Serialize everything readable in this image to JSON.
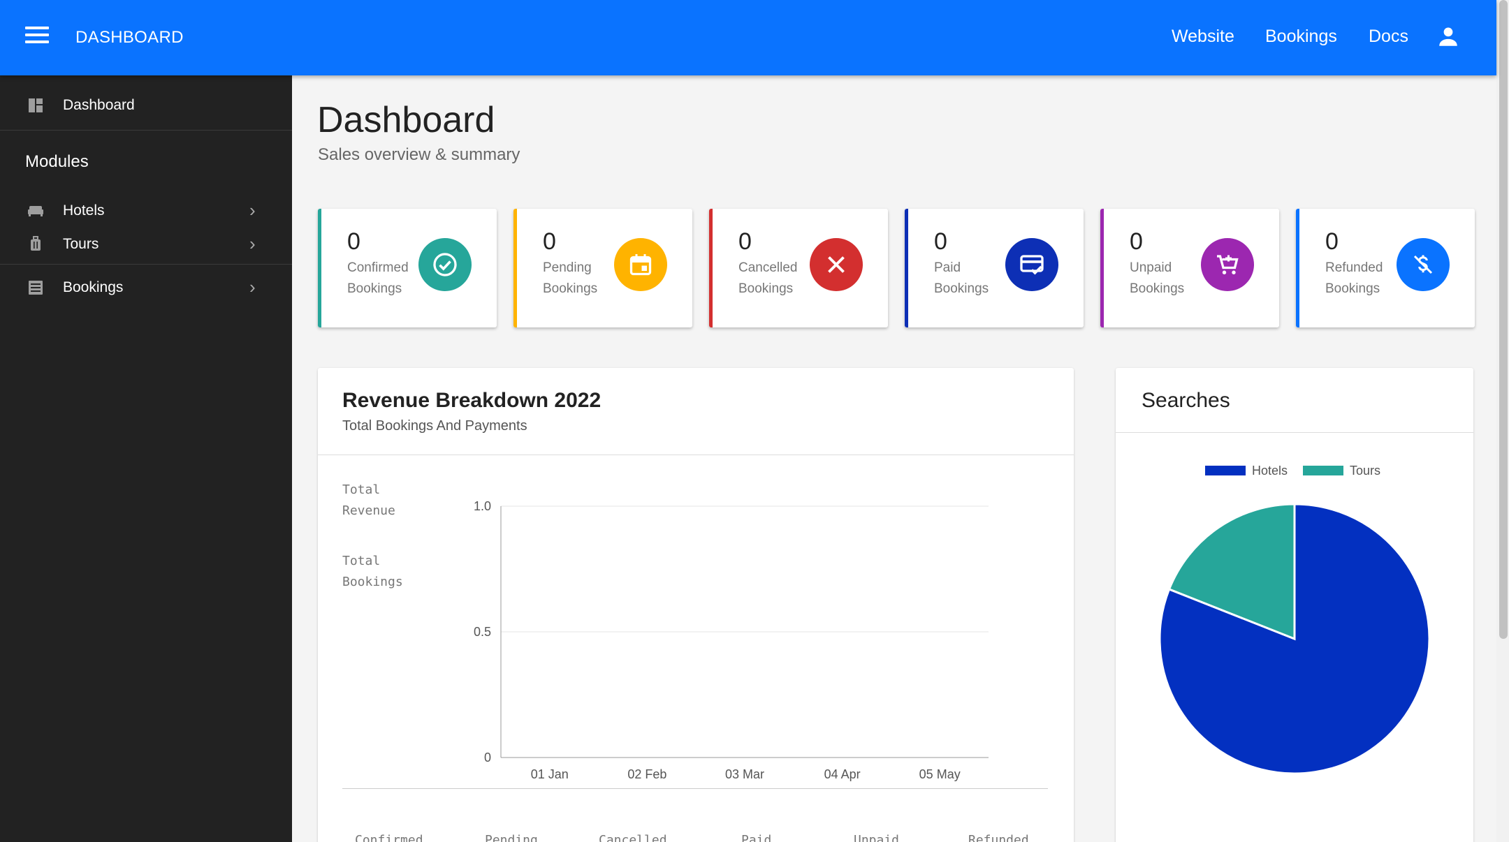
{
  "topbar": {
    "app_title": "DASHBOARD",
    "nav": [
      "Website",
      "Bookings",
      "Docs"
    ],
    "menu_icon": "hamburger-menu-icon",
    "user_icon": "account-icon",
    "color": "#0a73ff"
  },
  "sidebar": {
    "dashboard_label": "Dashboard",
    "modules_heading": "Modules",
    "items": [
      {
        "label": "Hotels",
        "icon": "bed-icon"
      },
      {
        "label": "Tours",
        "icon": "luggage-icon"
      },
      {
        "label": "Bookings",
        "icon": "list-icon"
      }
    ]
  },
  "page": {
    "title": "Dashboard",
    "subtitle": "Sales overview & summary"
  },
  "stats": [
    {
      "value": "0",
      "line1": "Confirmed",
      "line2": "Bookings",
      "color": "#26a69a",
      "icon": "check-circle-icon"
    },
    {
      "value": "0",
      "line1": "Pending",
      "line2": "Bookings",
      "color": "#ffb300",
      "icon": "calendar-icon"
    },
    {
      "value": "0",
      "line1": "Cancelled",
      "line2": "Bookings",
      "color": "#d32f2f",
      "icon": "close-icon"
    },
    {
      "value": "0",
      "line1": "Paid",
      "line2": "Bookings",
      "color": "#0d2fb5",
      "icon": "payment-check-icon"
    },
    {
      "value": "0",
      "line1": "Unpaid",
      "line2": "Bookings",
      "color": "#9c27b0",
      "icon": "cart-icon"
    },
    {
      "value": "0",
      "line1": "Refunded",
      "line2": "Bookings",
      "color": "#0a73ff",
      "icon": "no-dollar-icon"
    }
  ],
  "revenue": {
    "title": "Revenue Breakdown 2022",
    "subtitle": "Total Bookings And Payments",
    "legend_line1": [
      "Total",
      "Revenue"
    ],
    "legend_line2": [
      "Total",
      "Bookings"
    ],
    "footer_cols": [
      "Confirmed",
      "Pending",
      "Cancelled",
      "Paid",
      "Unpaid",
      "Refunded"
    ]
  },
  "searches": {
    "title": "Searches"
  },
  "chart_data": [
    {
      "type": "line",
      "title": "",
      "x": [
        "01 Jan",
        "02 Feb",
        "03 Mar",
        "04 Apr",
        "05 May"
      ],
      "y_ticks": [
        "0",
        "0.5",
        "1.0"
      ],
      "ylim": [
        0,
        1
      ],
      "grid": true,
      "series": []
    },
    {
      "type": "pie",
      "title": "",
      "categories": [
        "Hotels",
        "Tours"
      ],
      "values": [
        81,
        19
      ],
      "colors": [
        "#0330c0",
        "#26a69a"
      ],
      "legend": "top"
    }
  ]
}
